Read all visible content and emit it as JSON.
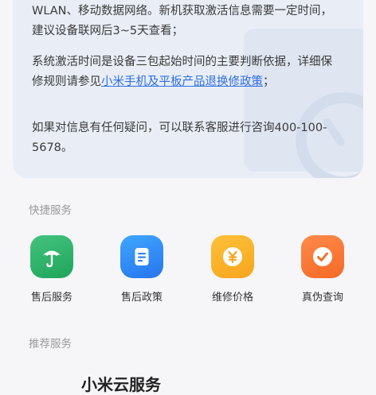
{
  "info": {
    "p1": "WLAN、移动数据网络。新机获取激活信息需要一定时间，建议设备联网后3~5天查看；",
    "p2_before": "系统激活时间是设备三包起始时间的主要判断依据，详细保修规则请参见",
    "p2_link": "小米手机及平板产品退换修政策",
    "p2_after": "；",
    "p3": "如果对信息有任何疑问，可以联系客服进行咨询400-100-5678。"
  },
  "quick": {
    "title": "快捷服务",
    "items": [
      {
        "label": "售后服务",
        "icon": "umbrella-icon",
        "color": "#2db36a"
      },
      {
        "label": "售后政策",
        "icon": "document-icon",
        "color": "#2f86f6"
      },
      {
        "label": "维修价格",
        "icon": "yen-coin-icon",
        "color": "#fbb12a"
      },
      {
        "label": "真伪查询",
        "icon": "verified-badge-icon",
        "color": "#f77a35"
      }
    ]
  },
  "recommend": {
    "title": "推荐服务",
    "first_item": "小米云服务"
  }
}
